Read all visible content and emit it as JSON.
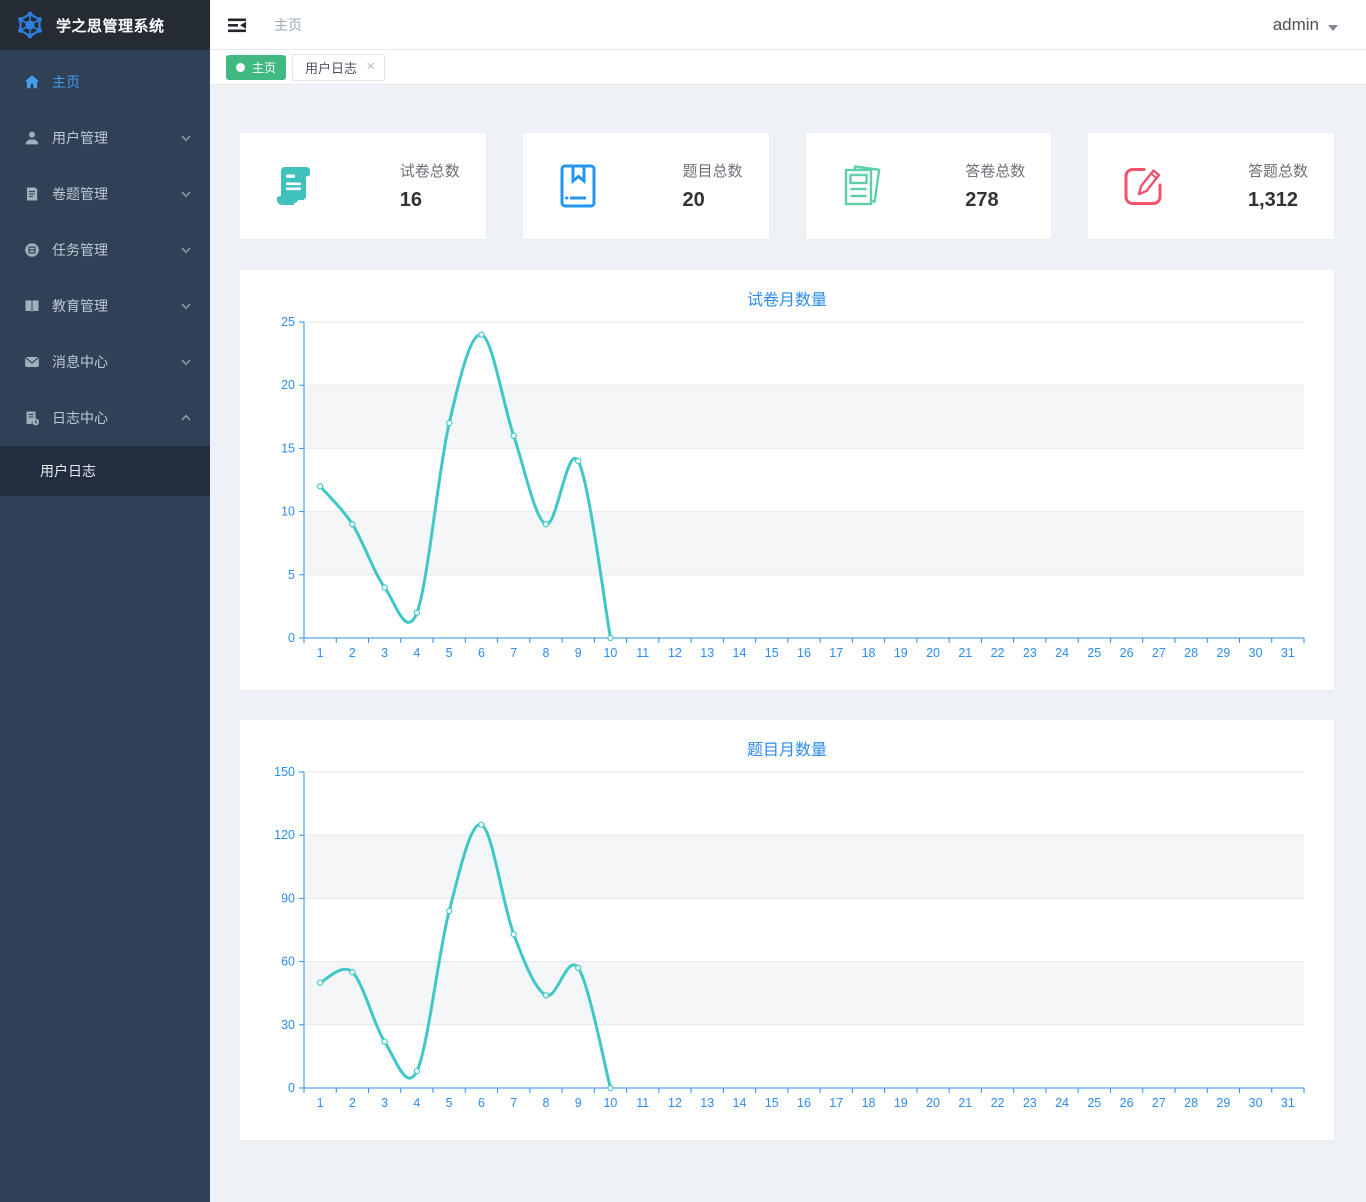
{
  "app": {
    "title": "学之思管理系统"
  },
  "header": {
    "breadcrumb": "主页",
    "user": "admin"
  },
  "tabs": [
    {
      "label": "主页",
      "style": "green-tag",
      "closable": false
    },
    {
      "label": "用户日志",
      "style": "plain",
      "closable": true
    }
  ],
  "sidebar": {
    "items": [
      {
        "id": "home",
        "label": "主页",
        "icon": "home",
        "active": true,
        "expandable": false
      },
      {
        "id": "user-mgmt",
        "label": "用户管理",
        "icon": "user",
        "expandable": true
      },
      {
        "id": "paper-mgmt",
        "label": "卷题管理",
        "icon": "paper",
        "expandable": true
      },
      {
        "id": "task-mgmt",
        "label": "任务管理",
        "icon": "task",
        "expandable": true
      },
      {
        "id": "edu-mgmt",
        "label": "教育管理",
        "icon": "education",
        "expandable": true
      },
      {
        "id": "message-center",
        "label": "消息中心",
        "icon": "message",
        "expandable": true
      },
      {
        "id": "log-center",
        "label": "日志中心",
        "icon": "log",
        "expandable": true,
        "expanded": true,
        "children": [
          {
            "id": "user-log",
            "label": "用户日志",
            "active": true
          }
        ]
      }
    ]
  },
  "stats": [
    {
      "label": "试卷总数",
      "value": "16",
      "icon": "exam-scroll-icon",
      "color": "#3fc2bb"
    },
    {
      "label": "题目总数",
      "value": "20",
      "icon": "question-book-icon",
      "color": "#2196f3"
    },
    {
      "label": "答卷总数",
      "value": "278",
      "icon": "answer-sheets-icon",
      "color": "#5fd0a5"
    },
    {
      "label": "答题总数",
      "value": "1,312",
      "icon": "answer-edit-icon",
      "color": "#f0536b"
    }
  ],
  "chart_data": [
    {
      "type": "line",
      "title": "试卷月数量",
      "x_categories": [
        1,
        2,
        3,
        4,
        5,
        6,
        7,
        8,
        9,
        10,
        11,
        12,
        13,
        14,
        15,
        16,
        17,
        18,
        19,
        20,
        21,
        22,
        23,
        24,
        25,
        26,
        27,
        28,
        29,
        30,
        31
      ],
      "values": [
        12,
        9,
        4,
        2,
        17,
        24,
        16,
        9,
        14,
        0
      ],
      "ylim": [
        0,
        25
      ],
      "y_ticks": [
        0,
        5,
        10,
        15,
        20,
        25
      ],
      "line_color": "#3fc8c6",
      "axis_color": "#2d8cf0",
      "band_color": "#f5f6f7",
      "grid_color": "#e6e9ec",
      "smooth": true,
      "legend": "none"
    },
    {
      "type": "line",
      "title": "题目月数量",
      "x_categories": [
        1,
        2,
        3,
        4,
        5,
        6,
        7,
        8,
        9,
        10,
        11,
        12,
        13,
        14,
        15,
        16,
        17,
        18,
        19,
        20,
        21,
        22,
        23,
        24,
        25,
        26,
        27,
        28,
        29,
        30,
        31
      ],
      "values": [
        50,
        55,
        22,
        8,
        84,
        125,
        73,
        44,
        57,
        0
      ],
      "ylim": [
        0,
        150
      ],
      "y_ticks": [
        0,
        30,
        60,
        90,
        120,
        150
      ],
      "line_color": "#3fc8c6",
      "axis_color": "#2d8cf0",
      "band_color": "#f5f6f7",
      "grid_color": "#e6e9ec",
      "smooth": true,
      "legend": "none"
    }
  ]
}
